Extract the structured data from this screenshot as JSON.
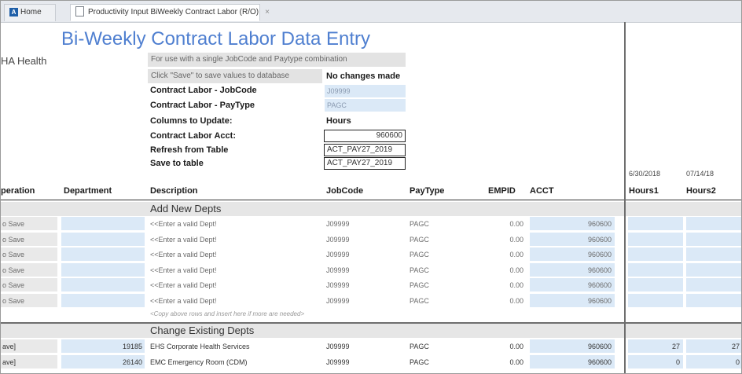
{
  "tabs": {
    "home_label": "Home",
    "active_label": "Productivity Input BiWeekly Contract Labor (R/O)",
    "close_glyph": "×"
  },
  "header": {
    "title": "Bi-Weekly Contract Labor Data Entry",
    "org": "HA Health",
    "info_line1": "For use with a single JobCode and Paytype combination",
    "info_line2": "Click \"Save\" to save values to database",
    "status": "No changes made"
  },
  "params": {
    "jobcode_label": "Contract Labor - JobCode",
    "jobcode_value": "J09999",
    "paytype_label": "Contract Labor - PayType",
    "paytype_value": "PAGC",
    "columns_label": "Columns to Update:",
    "columns_value": "Hours",
    "acct_label": "Contract Labor Acct:",
    "acct_value": "960600",
    "refresh_label": "Refresh from Table",
    "refresh_value": "ACT_PAY27_2019",
    "save_label": "Save to table",
    "save_value": "ACT_PAY27_2019"
  },
  "columns": {
    "operation": "peration",
    "department": "Department",
    "description": "Description",
    "jobcode": "JobCode",
    "paytype": "PayType",
    "empid": "EMPID",
    "acct": "ACCT",
    "date1": "6/30/2018",
    "hours1": "Hours1",
    "date2": "07/14/18",
    "hours2": "Hours2"
  },
  "sections": {
    "add_new": "Add New Depts",
    "change_existing": "Change Existing Depts",
    "copy_note": "<Copy above rows and insert here if more are needed>"
  },
  "new_rows": [
    {
      "op": "o Save",
      "dept": "",
      "desc": "<<Enter a valid Dept!",
      "job": "J09999",
      "pay": "PAGC",
      "empid": "0.00",
      "acct": "960600",
      "h1": "",
      "h2": ""
    },
    {
      "op": "o Save",
      "dept": "",
      "desc": "<<Enter a valid Dept!",
      "job": "J09999",
      "pay": "PAGC",
      "empid": "0.00",
      "acct": "960600",
      "h1": "",
      "h2": ""
    },
    {
      "op": "o Save",
      "dept": "",
      "desc": "<<Enter a valid Dept!",
      "job": "J09999",
      "pay": "PAGC",
      "empid": "0.00",
      "acct": "960600",
      "h1": "",
      "h2": ""
    },
    {
      "op": "o Save",
      "dept": "",
      "desc": "<<Enter a valid Dept!",
      "job": "J09999",
      "pay": "PAGC",
      "empid": "0.00",
      "acct": "960600",
      "h1": "",
      "h2": ""
    },
    {
      "op": "o Save",
      "dept": "",
      "desc": "<<Enter a valid Dept!",
      "job": "J09999",
      "pay": "PAGC",
      "empid": "0.00",
      "acct": "960600",
      "h1": "",
      "h2": ""
    },
    {
      "op": "o Save",
      "dept": "",
      "desc": "<<Enter a valid Dept!",
      "job": "J09999",
      "pay": "PAGC",
      "empid": "0.00",
      "acct": "960600",
      "h1": "",
      "h2": ""
    }
  ],
  "existing_rows": [
    {
      "op": "ave]",
      "dept": "19185",
      "desc": "EHS Corporate Health Services",
      "job": "J09999",
      "pay": "PAGC",
      "empid": "0.00",
      "acct": "960600",
      "h1": "27",
      "h2": "27"
    },
    {
      "op": "ave]",
      "dept": "26140",
      "desc": "EMC Emergency Room (CDM)",
      "job": "J09999",
      "pay": "PAGC",
      "empid": "0.00",
      "acct": "960600",
      "h1": "0",
      "h2": "0"
    }
  ]
}
